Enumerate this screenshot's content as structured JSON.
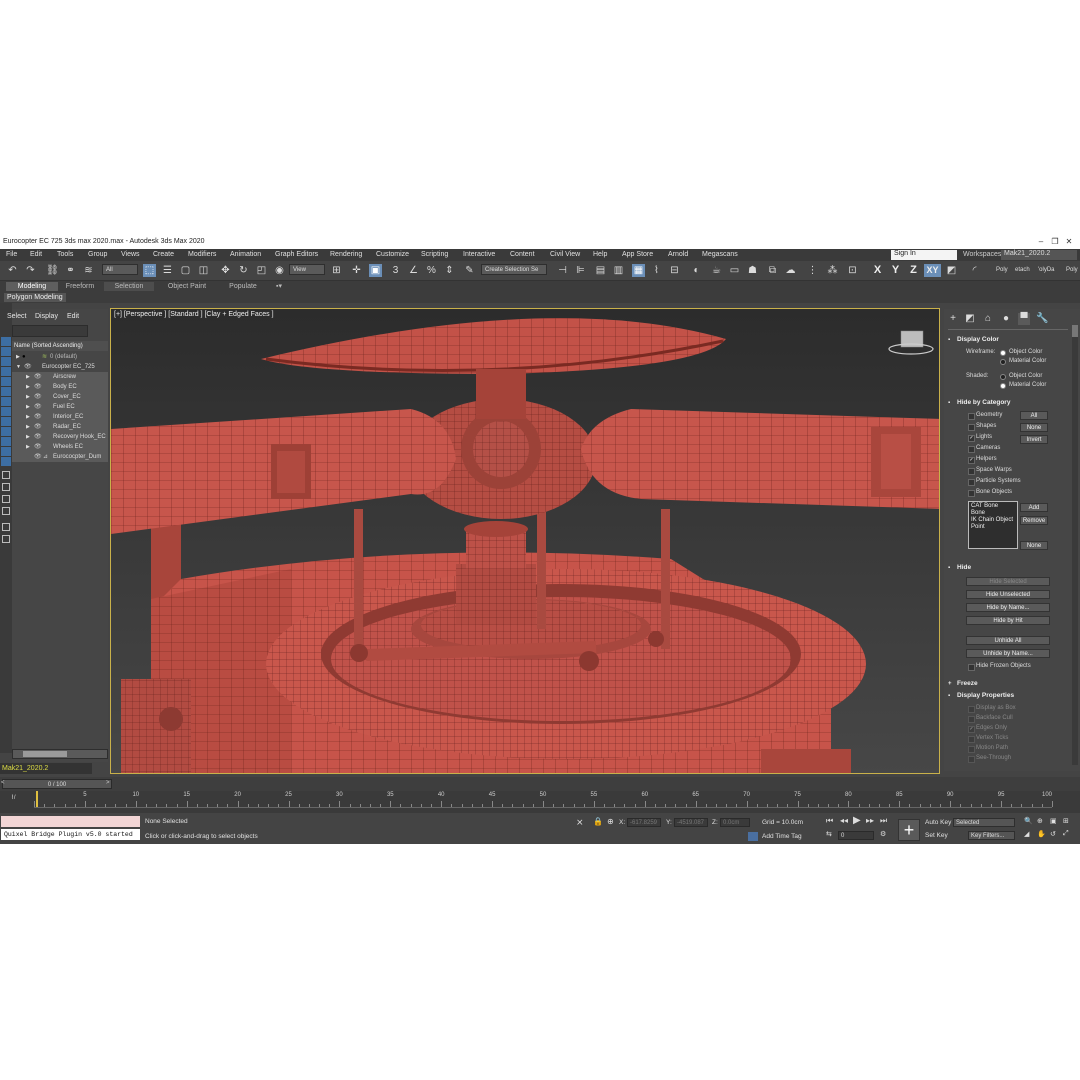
{
  "title": "Eurocopter EC 725 3ds max 2020.max - Autodesk 3ds Max 2020",
  "window_controls": {
    "minimize": "–",
    "maximize": "❐",
    "close": "✕"
  },
  "menu": [
    "File",
    "Edit",
    "Tools",
    "Group",
    "Views",
    "Create",
    "Modifiers",
    "Animation",
    "Graph Editors",
    "Rendering",
    "Customize",
    "Scripting",
    "Interactive",
    "Content",
    "Civil View",
    "Help",
    "App Store",
    "Arnold",
    "Megascans"
  ],
  "account": {
    "sign_in": "Sign In",
    "workspaces_label": "Workspaces:",
    "workspace": "Mak21_2020.2"
  },
  "toolbar": {
    "selection_filter": "All",
    "ref_coord": "View",
    "selection_set_placeholder": "Create Selection Se",
    "axis_x": "X",
    "axis_y": "Y",
    "axis_z": "Z",
    "axis_xy": "XY",
    "right_labels": [
      "Poly",
      "etach",
      "'olyDa",
      "Poly"
    ]
  },
  "ribbon": {
    "tabs": [
      "Modeling",
      "Freeform",
      "Selection",
      "Object Paint",
      "Populate"
    ],
    "subpanel": "Polygon Modeling"
  },
  "explorer": {
    "menu": [
      "Select",
      "Display",
      "Edit"
    ],
    "column_header": "Name (Sorted Ascending)",
    "rows": [
      {
        "label": "0 (default)"
      },
      {
        "label": "Eurocopter EC_725"
      },
      {
        "label": "Airscrew"
      },
      {
        "label": "Body EC"
      },
      {
        "label": "Cover_EC"
      },
      {
        "label": "Fuel EC"
      },
      {
        "label": "Interior_EC"
      },
      {
        "label": "Radar_EC"
      },
      {
        "label": "Recovery Hook_EC"
      },
      {
        "label": "Wheels EC"
      },
      {
        "label": "Eurococpter_Dum"
      }
    ],
    "layer": "Mak21_2020.2"
  },
  "viewport": {
    "label": "[+] [Perspective ] [Standard ] [Clay + Edged Faces ]"
  },
  "command_panel": {
    "display_color": {
      "title": "Display Color",
      "wireframe_label": "Wireframe:",
      "shaded_label": "Shaded:",
      "object_color": "Object Color",
      "material_color": "Material Color"
    },
    "hide_by_category": {
      "title": "Hide by Category",
      "items": [
        "Geometry",
        "Shapes",
        "Lights",
        "Cameras",
        "Helpers",
        "Space Warps",
        "Particle Systems",
        "Bone Objects"
      ],
      "buttons": [
        "All",
        "None",
        "Invert"
      ],
      "list": [
        "CAT Bone",
        "Bone",
        "IK Chain Object",
        "Point"
      ],
      "list_buttons": [
        "Add",
        "Remove",
        "None"
      ]
    },
    "hide": {
      "title": "Hide",
      "buttons": [
        "Hide Selected",
        "Hide Unselected",
        "Hide by Name...",
        "Hide by Hit",
        "Unhide All",
        "Unhide by Name..."
      ],
      "hide_frozen": "Hide Frozen Objects"
    },
    "freeze": {
      "title": "Freeze"
    },
    "display_properties": {
      "title": "Display Properties",
      "items": [
        "Display as Box",
        "Backface Cull",
        "Edges Only",
        "Vertex Ticks",
        "Motion Path",
        "See-Through"
      ]
    }
  },
  "timeline": {
    "slider": "0 / 100",
    "ticks": [
      "5",
      "10",
      "15",
      "20",
      "25",
      "30",
      "35",
      "40",
      "45",
      "50",
      "55",
      "60",
      "65",
      "70",
      "75",
      "80",
      "85",
      "90",
      "95",
      "100"
    ]
  },
  "status": {
    "maxscript_output": "Quixel Bridge Plugin v5.0 started",
    "selection": "None Selected",
    "prompt": "Click or click-and-drag to select objects",
    "x_label": "X:",
    "x_value": "-617.8259",
    "y_label": "Y:",
    "y_value": "-4519.087",
    "z_label": "Z:",
    "z_value": "0.0cm",
    "grid": "Grid = 10.0cm",
    "add_time_tag": "Add Time Tag",
    "frame": "0",
    "auto_key": "Auto Key",
    "set_key": "Set Key",
    "key_mode": "Selected",
    "key_filters": "Key Filters..."
  },
  "colors": {
    "model": "#c9564a",
    "accent": "#6b8fb8",
    "viewport_border": "#c9b14a"
  }
}
